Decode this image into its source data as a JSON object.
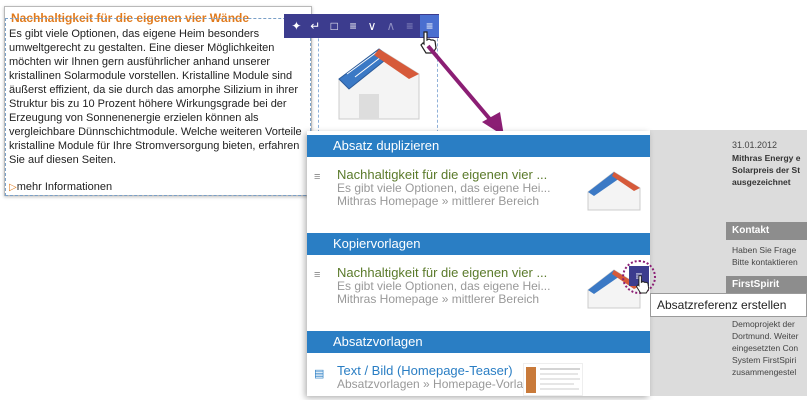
{
  "editor": {
    "title": "Nachhaltigkeit für die eigenen vier Wände",
    "lines": [
      "Es gibt viele Optionen, das eigene Heim besonders",
      "umweltgerecht zu gestalten. Eine dieser Möglichkeiten",
      "möchten wir Ihnen gern ausführlicher anhand unserer",
      "kristallinen Solarmodule vorstellen. Kristalline Module sind",
      "äußerst effizient, da sie durch das amorphe Silizium in ihrer",
      "Struktur bis zu 10 Prozent höhere Wirkungsgrade bei der",
      "Erzeugung von Sonnenenergie erzielen können als",
      "vergleichbare Dünnschichtmodule. Welche weiteren Vorteile",
      "kristalline Module für Ihre Stromversorgung bieten, erfahren",
      "Sie auf diesen Seiten."
    ],
    "more_link": "mehr Informationen"
  },
  "toolbar": {
    "icons": [
      "move-icon",
      "share-icon",
      "delete-icon",
      "paragraph-menu-icon",
      "chevron-down-icon",
      "up-icon",
      "paragraph-list-icon",
      "paragraph-ref-icon"
    ]
  },
  "site": {
    "news_date": "31.01.2012",
    "news_lines": [
      "Mithras Energy e",
      "Solarpreis der St",
      "ausgezeichnet"
    ],
    "kontakt_header": "Kontakt",
    "kontakt_lines": [
      "Haben Sie Frage",
      "Bitte kontaktieren"
    ],
    "firstspirit_header": "FirstSpirit",
    "fs_lines": [
      "Demoprojekt der",
      "Dortmund. Weiter",
      "eingesetzten Con",
      "System FirstSpiri",
      "zusammengestel"
    ]
  },
  "dropdown": {
    "sections": [
      {
        "label": "Absatz duplizieren",
        "entry": {
          "line1": "Nachhaltigkeit für die eigenen vier ...",
          "line2": "Es gibt viele Optionen, das eigene Hei...",
          "line3": "Mithras Homepage » mittlerer Bereich"
        }
      },
      {
        "label": "Kopiervorlagen",
        "entry": {
          "line1": "Nachhaltigkeit für die eigenen vier ...",
          "line2": "Es gibt viele Optionen, das eigene Hei...",
          "line3": "Mithras Homepage » mittlerer Bereich"
        }
      },
      {
        "label": "Absatzvorlagen",
        "entry": {
          "line1": "Text / Bild (Homepage-Teaser)",
          "line2": "Absatzvorlagen » Homepage-Vorlagen"
        }
      }
    ]
  },
  "tooltip": "Absatzreferenz erstellen",
  "colors": {
    "accent": "#2a7ec4",
    "toolbar": "#3c3c8e",
    "title_orange": "#e07a1c",
    "arrow": "#8b1e74"
  }
}
